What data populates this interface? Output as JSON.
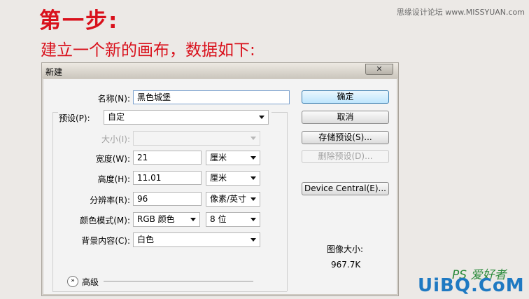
{
  "header": {
    "step": "第一步:",
    "subtitle": "建立一个新的画布，数据如下:",
    "site": "思缘设计论坛 www.MISSYUAN.com"
  },
  "dialog": {
    "title": "新建",
    "close": "✕",
    "name_label": "名称(N):",
    "name_value": "黑色城堡",
    "preset_label": "预设(P):",
    "preset_value": "自定",
    "size_label": "大小(I):",
    "size_value": "",
    "width_label": "宽度(W):",
    "width_value": "21",
    "width_unit": "厘米",
    "height_label": "高度(H):",
    "height_value": "11.01",
    "height_unit": "厘米",
    "resolution_label": "分辨率(R):",
    "resolution_value": "96",
    "resolution_unit": "像素/英寸",
    "color_mode_label": "颜色模式(M):",
    "color_mode_value": "RGB 颜色",
    "bit_depth_value": "8 位",
    "background_label": "背景内容(C):",
    "background_value": "白色",
    "advanced_label": "高级",
    "advanced_icon": "»",
    "buttons": {
      "ok": "确定",
      "cancel": "取消",
      "save_preset": "存储预设(S)...",
      "delete_preset": "删除预设(D)...",
      "device_central": "Device Central(E)..."
    },
    "image_size_label": "图像大小:",
    "image_size_value": "967.7K"
  },
  "watermark": {
    "line1": "PS 爱好者",
    "line2": "UiBQ.CoM"
  },
  "colors": {
    "heading_red": "#d9101b",
    "primary_button": "#bee6fd"
  }
}
